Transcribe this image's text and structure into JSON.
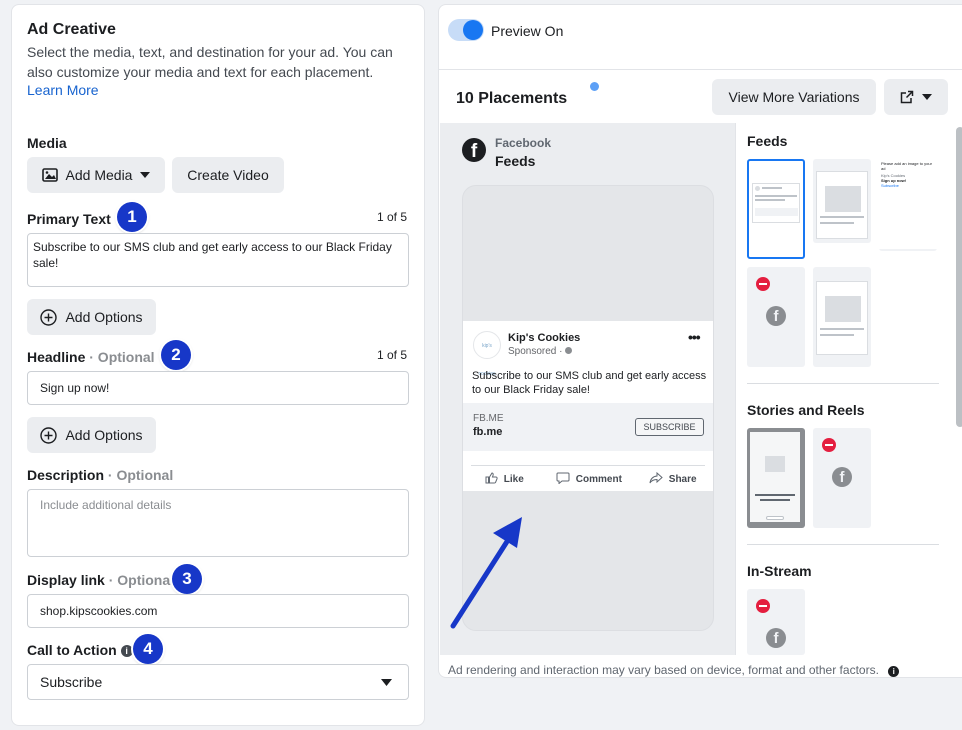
{
  "left": {
    "title": "Ad Creative",
    "description": "Select the media, text, and destination for your ad. You can also customize your media and text for each placement.",
    "learn_more": "Learn More",
    "media_label": "Media",
    "add_media": "Add Media",
    "create_video": "Create Video",
    "primary_text": {
      "label": "Primary Text",
      "badge": "1",
      "count": "1 of 5",
      "value": "Subscribe to our SMS club and get early access to our Black Friday sale!",
      "add_options": "Add Options"
    },
    "headline": {
      "label": "Headline",
      "optional": " · Optional",
      "badge": "2",
      "count": "1 of 5",
      "value": "Sign up now!",
      "add_options": "Add Options"
    },
    "description_field": {
      "label": "Description",
      "optional": " · Optional",
      "placeholder": "Include additional details"
    },
    "display_link": {
      "label": "Display link",
      "optional": " · Optional",
      "badge": "3",
      "value": "shop.kipscookies.com"
    },
    "cta": {
      "label": "Call to Action",
      "badge": "4",
      "value": "Subscribe"
    }
  },
  "right": {
    "toggle_label": "Preview On",
    "toggle_on": true,
    "placements_title": "10 Placements",
    "view_more": "View More Variations",
    "preview": {
      "platform": "Facebook",
      "placement": "Feeds",
      "page_name": "Kip's Cookies",
      "sponsored": "Sponsored · ",
      "primary_text": "Subscribe to our SMS club and get early access to our Black Friday sale!",
      "link_domain": "FB.ME",
      "link_title": "fb.me",
      "cta": "SUBSCRIBE",
      "like": "Like",
      "comment": "Comment",
      "share": "Share",
      "logo_text": "kip's cookies"
    },
    "sections": {
      "feeds": "Feeds",
      "stories": "Stories and Reels",
      "instream": "In-Stream"
    },
    "thumb_headline": "Sign up now!",
    "thumb_cta": "Subscribe",
    "thumb_notice": "Please add an image to your ad",
    "thumb_page": "Kip's Cookies",
    "footer_note": "Ad rendering and interaction may vary based on device, format and other factors.",
    "accent_color": "#1877f2",
    "badge_color": "#1737c8"
  }
}
